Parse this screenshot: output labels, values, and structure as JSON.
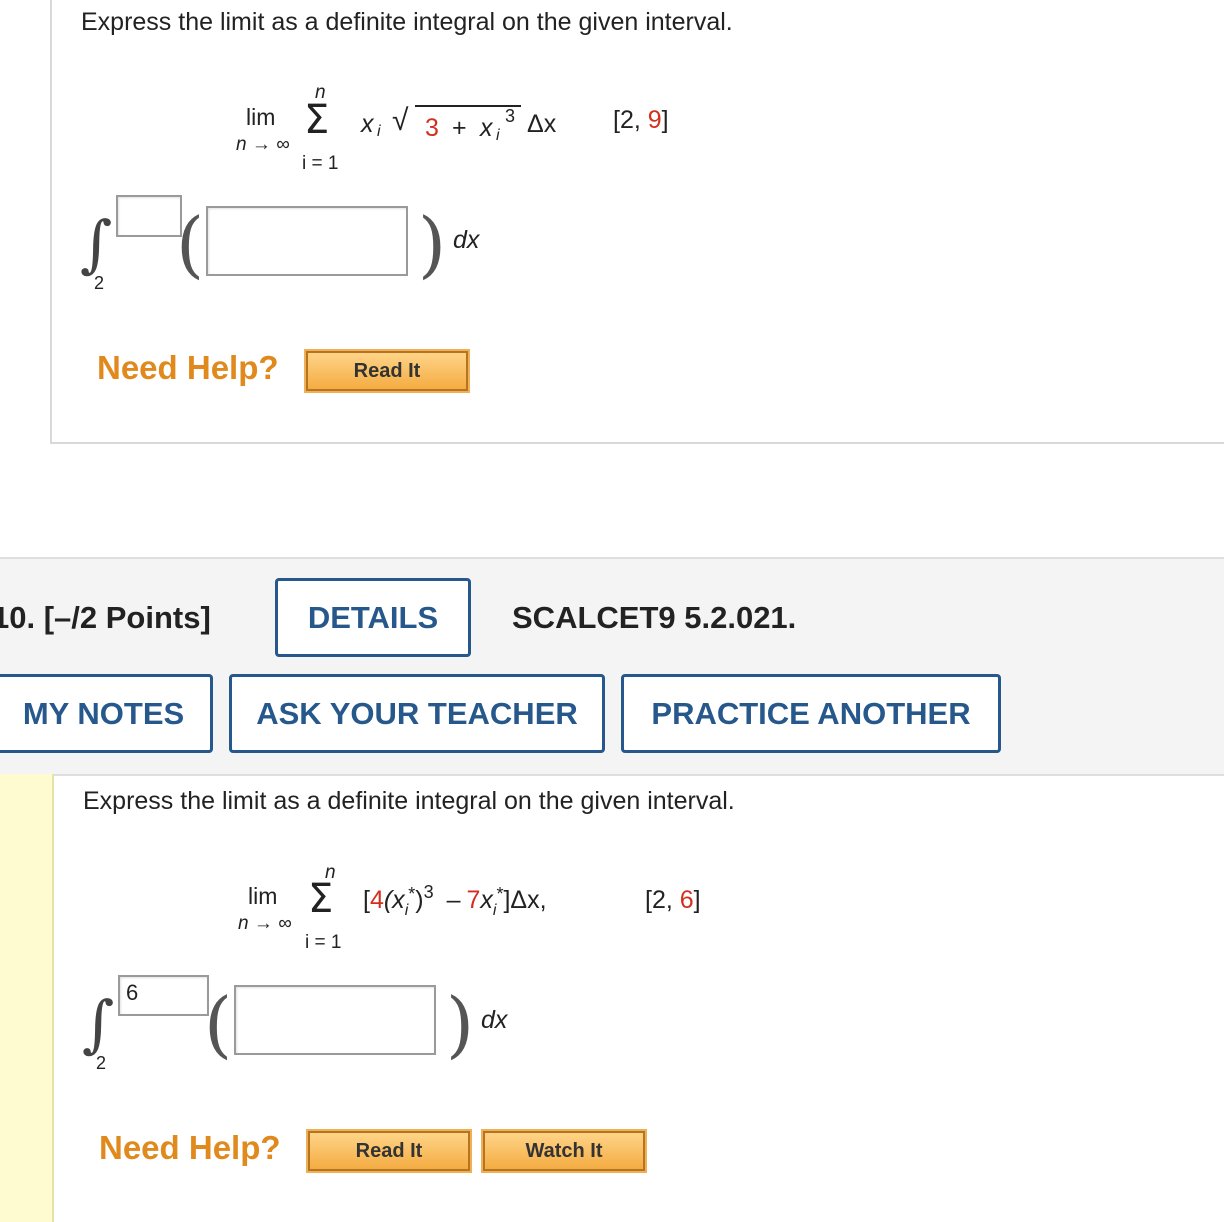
{
  "q9": {
    "prompt": "Express the limit as a definite integral on the given interval.",
    "lim": "lim",
    "lim_sub": "n → ∞",
    "sigma": "Σ",
    "sum_top": "n",
    "sum_bottom": "i = 1",
    "term_x": "x",
    "term_i": "i",
    "radical": "√",
    "rad_3": "3",
    "rad_plus": "+",
    "rad_x": "x",
    "rad_sub_i": "i",
    "rad_exp": "3",
    "delta_x": "Δx",
    "interval_open": "[2,",
    "interval_upper": "9",
    "interval_close": "]",
    "integral_sign": "∫",
    "lower_limit": "2",
    "upper_box_value": "",
    "integrand_value": "",
    "dx": "dx",
    "need_help": "Need Help?",
    "read_it": "Read It"
  },
  "q10": {
    "points_label": "10.  [–/2 Points]",
    "details_label": "DETAILS",
    "ref_code": "SCALCET9 5.2.021.",
    "my_notes": "MY NOTES",
    "ask_teacher": "ASK YOUR TEACHER",
    "practice_another": "PRACTICE ANOTHER",
    "prompt": "Express the limit as a definite integral on the given interval.",
    "lim": "lim",
    "lim_sub": "n → ∞",
    "sigma": "Σ",
    "sum_top": "n",
    "sum_bottom": "i = 1",
    "term_open": "[",
    "coef_4": "4",
    "term_xi_open": "(x",
    "sub_i": "i",
    "star": "*",
    "close_paren": ")",
    "exp_3": "3",
    "minus": "–",
    "coef_7": "7",
    "term_x2": "x",
    "sub_i2": "i",
    "star2": "*",
    "term_close": "]Δx,",
    "interval_open": "[2,",
    "interval_upper": "6",
    "interval_close": "]",
    "integral_sign": "∫",
    "lower_limit": "2",
    "upper_box_value": "6",
    "integrand_value": "",
    "dx": "dx",
    "need_help": "Need Help?",
    "read_it": "Read It",
    "watch_it": "Watch It"
  },
  "colors": {
    "accent_blue": "#26588c",
    "help_orange": "#e08a1e",
    "highlight_red": "#d32f1f",
    "button_gold": "#f4ac42",
    "gutter_yellow": "#fefbd1"
  }
}
